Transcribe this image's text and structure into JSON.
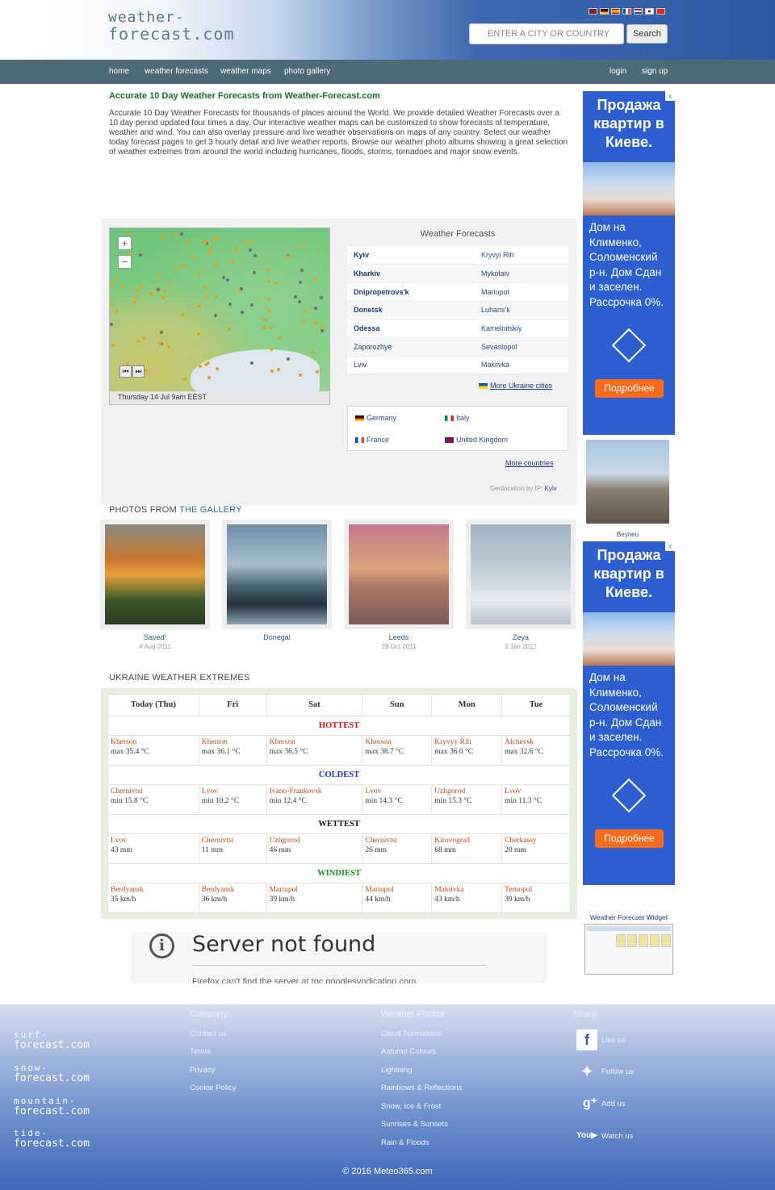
{
  "header": {
    "logo_line1": "weather-",
    "logo_line2": "forecast.com",
    "search_placeholder": "ENTER A CITY OR COUNTRY",
    "search_button": "Search"
  },
  "nav": {
    "items": [
      "home",
      "weather forecasts",
      "weather maps",
      "photo gallery"
    ],
    "login": "login",
    "signup": "sign up"
  },
  "intro": {
    "title": "Accurate 10 Day Weather Forecasts from Weather-Forecast.com",
    "text": "Accurate 10 Day Weather Forecasts for thousands of places around the World. We provide detailed Weather Forecasts over a 10 day period updated four times a day. Our interactive weather maps can be customized to show forecasts of temperature, weather and wind. You can also overlay pressure and live weather observations on maps of any country. Select our weather today forecast pages to get 3 hourly detail and live weather reports. Browse our weather photo albums showing a great selection of weather extremes from around the world including hurricanes, floods, storms, tornadoes and major snow events."
  },
  "map": {
    "caption": "Thursday 14 Jul 9am EEST",
    "zoom_in": "+",
    "zoom_out": "−"
  },
  "forecasts": {
    "title": "Weather Forecasts",
    "rows": [
      {
        "left": "Kyiv",
        "right": "Kryvyi Rih"
      },
      {
        "left": "Kharkiv",
        "right": "Mykolaiv"
      },
      {
        "left": "Dnipropetrovs'k",
        "right": "Mariupol"
      },
      {
        "left": "Donetsk",
        "right": "Luhans'k"
      },
      {
        "left": "Odessa",
        "right": "Kamelnitskiy"
      },
      {
        "left": "Zaporozhye",
        "right": "Sevastopol"
      },
      {
        "left": "Lviv",
        "right": "Makiivka"
      }
    ],
    "more_cities": "More Ukraine cities",
    "countries": [
      "Germany",
      "Italy",
      "France",
      "United Kingdom"
    ],
    "more_countries": "More countries",
    "geo_label": "Geolocation by IP:",
    "geo_city": "Kyiv"
  },
  "gallery": {
    "heading_a": "PHOTOS FROM",
    "heading_b": "THE GALLERY",
    "photos": [
      {
        "title": "Saved!",
        "date": "4 Aug 2011"
      },
      {
        "title": "Donegal",
        "date": ""
      },
      {
        "title": "Leeds",
        "date": "28 Oct 2011"
      },
      {
        "title": "Zeya",
        "date": "2 Jan 2012"
      }
    ]
  },
  "extremes": {
    "heading": "UKRAINE WEATHER EXTREMES",
    "days": [
      "Today (Thu)",
      "Fri",
      "Sat",
      "Sun",
      "Mon",
      "Tue"
    ],
    "hottest_label": "HOTTEST",
    "hottest": [
      {
        "loc": "Kherson",
        "val": "max 35.4 °C"
      },
      {
        "loc": "Kherson",
        "val": "max 36.1 °C"
      },
      {
        "loc": "Kherson",
        "val": "max 36.5 °C"
      },
      {
        "loc": "Kherson",
        "val": "max 38.7 °C"
      },
      {
        "loc": "Kryvyy Rih",
        "val": "max 36.0 °C"
      },
      {
        "loc": "Alchevsk",
        "val": "max 32.6 °C"
      }
    ],
    "coldest_label": "COLDEST",
    "coldest": [
      {
        "loc": "Chernivtsi",
        "val": "min 15.8 °C"
      },
      {
        "loc": "Lvov",
        "val": "min 10.2 °C"
      },
      {
        "loc": "Ivano-Frankovsk",
        "val": "min 12.4 °C"
      },
      {
        "loc": "Lvov",
        "val": "min 14.3 °C"
      },
      {
        "loc": "Uzhgorod",
        "val": "min 15.3 °C"
      },
      {
        "loc": "Lvov",
        "val": "min 11.3 °C"
      }
    ],
    "wettest_label": "WETTEST",
    "wettest": [
      {
        "loc": "Lvov",
        "val": "43 mm"
      },
      {
        "loc": "Chernivtsi",
        "val": "11 mm"
      },
      {
        "loc": "Uzhgorod",
        "val": "46 mm"
      },
      {
        "loc": "Chernivtsi",
        "val": "26 mm"
      },
      {
        "loc": "Kirovograd",
        "val": "68 mm"
      },
      {
        "loc": "Cherkassy",
        "val": "20 mm"
      }
    ],
    "windiest_label": "WINDIEST",
    "windiest": [
      {
        "loc": "Berdyansk",
        "val": "35 km/h"
      },
      {
        "loc": "Berdyansk",
        "val": "36 km/h"
      },
      {
        "loc": "Mariupol",
        "val": "39 km/h"
      },
      {
        "loc": "Mariupol",
        "val": "44 km/h"
      },
      {
        "loc": "Makiivka",
        "val": "43 km/h"
      },
      {
        "loc": "Ternopol",
        "val": "39 km/h"
      }
    ]
  },
  "ad": {
    "title": "Продажа квартир в Киеве.",
    "text": "Дом на Клименко, Соломенский р-н. Дом Сдан и заселен. Рассрочка 0%.",
    "button": "Подробнее",
    "close": "x"
  },
  "sidebar": {
    "photo_caption": "Beyneu",
    "widget_title": "Weather Forecast Widget"
  },
  "server_error": {
    "title": "Server not found",
    "sub": "Firefox can't find the server at tpc.googlesyndication.com."
  },
  "footer": {
    "brands": [
      {
        "a": "surf-",
        "b": "forecast.com"
      },
      {
        "a": "snow-",
        "b": "forecast.com"
      },
      {
        "a": "mountain-",
        "b": "forecast.com"
      },
      {
        "a": "tide-",
        "b": "forecast.com"
      }
    ],
    "company_h": "Company",
    "company": [
      "Contact us",
      "Terms",
      "Privacy",
      "Cookie Policy"
    ],
    "photos_h": "Weather Photos",
    "photos": [
      "Cloud Formations",
      "Autumn Colours",
      "Lightning",
      "Rainbows & Reflections",
      "Snow, Ice & Frost",
      "Sunrises & Sunsets",
      "Rain & Floods"
    ],
    "share_h": "Share",
    "share": [
      "Like us",
      "Follow us",
      "Add us",
      "Watch us"
    ],
    "copyright": "© 2016 Meteo365.com"
  }
}
